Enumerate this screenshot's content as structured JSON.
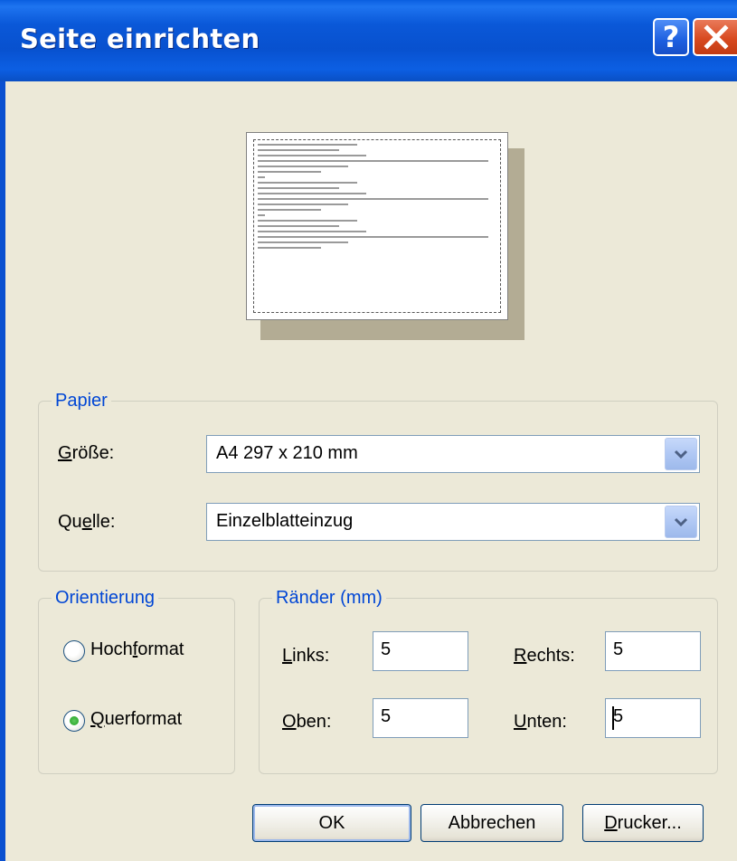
{
  "window": {
    "title": "Seite einrichten"
  },
  "title_buttons": {
    "help": "?",
    "close_icon": "close-icon"
  },
  "paper": {
    "legend": "Papier",
    "size_label_u": "G",
    "size_label_rest": "röße:",
    "size_value": "A4 297 x 210 mm",
    "source_label_pre": "Qu",
    "source_label_u": "e",
    "source_label_rest": "lle:",
    "source_value": "Einzelblatteinzug"
  },
  "orientation": {
    "legend": "Orientierung",
    "portrait_pre": "Hoch",
    "portrait_u": "f",
    "portrait_rest": "ormat",
    "landscape_u": "Q",
    "landscape_rest": "uerformat",
    "selected": "landscape"
  },
  "margins": {
    "legend": "Ränder (mm)",
    "left_u": "L",
    "left_rest": "inks:",
    "left_value": "5",
    "right_u": "R",
    "right_rest": "echts:",
    "right_value": "5",
    "top_u": "O",
    "top_rest": "ben:",
    "top_value": "5",
    "bottom_u": "U",
    "bottom_rest": "nten:",
    "bottom_value": "5"
  },
  "buttons": {
    "ok": "OK",
    "cancel": "Abbrechen",
    "printer_u": "D",
    "printer_rest": "rucker..."
  },
  "colors": {
    "title_bar": "#0A58D8",
    "accent": "#0046D5",
    "dialog_bg": "#ECE9D8"
  }
}
